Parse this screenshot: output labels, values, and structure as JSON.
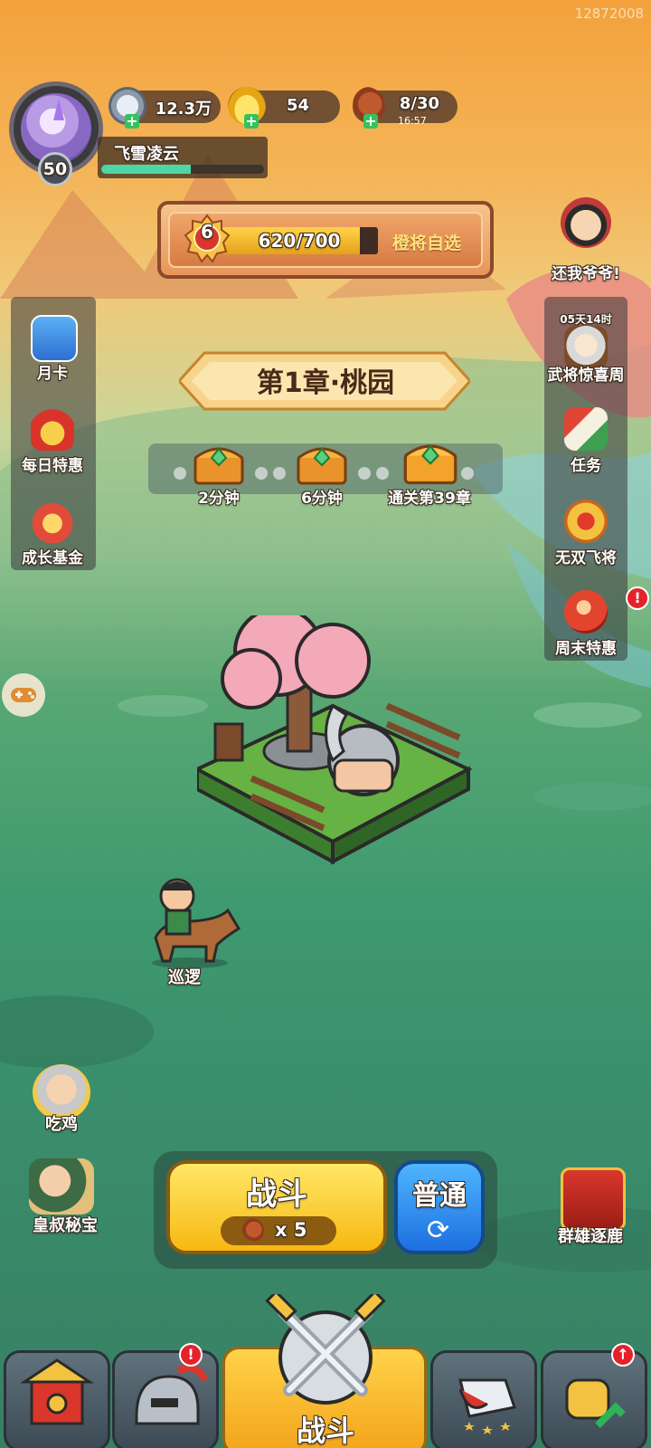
{
  "user_id": "12872008",
  "player": {
    "name": "飞雪凌云",
    "level": "50",
    "xp_fraction": 0.55
  },
  "resources": {
    "silver": {
      "value": "12.3万",
      "icon": "silver-coin-icon"
    },
    "gold": {
      "value": "54",
      "icon": "gold-ingot-icon"
    },
    "stamina": {
      "value": "8/30",
      "timer": "16:57",
      "icon": "meat-drumstick-icon"
    }
  },
  "quest": {
    "rank": "6",
    "progress": "620/700",
    "progress_fraction": 0.886,
    "link": "橙将自选"
  },
  "left_menu": [
    {
      "label": "月卡",
      "icon": "monthly-card-icon"
    },
    {
      "label": "每日特惠",
      "icon": "daily-deal-bag-icon"
    },
    {
      "label": "成长基金",
      "icon": "growth-fund-icon"
    }
  ],
  "right_top": {
    "label": "还我爷爷!",
    "icon": "zhang-fei-head-icon"
  },
  "right_menu": [
    {
      "label": "武将惊喜周",
      "timer": "05天14时",
      "icon": "general-surprise-icon"
    },
    {
      "label": "任务",
      "icon": "task-scroll-icon"
    },
    {
      "label": "无双飞将",
      "icon": "peerless-general-icon"
    },
    {
      "label": "周末特惠",
      "icon": "weekend-deal-icon",
      "alert": "!"
    }
  ],
  "chapter": {
    "title": "第1章·桃园",
    "chests": [
      {
        "label": "2分钟"
      },
      {
        "label": "6分钟"
      },
      {
        "label": "通关第39章"
      }
    ]
  },
  "hero": {
    "label": "巡逻"
  },
  "left_bottom": [
    {
      "label": "吃鸡",
      "icon": "chicken-dinner-icon"
    },
    {
      "label": "皇叔秘宝",
      "icon": "uncle-treasure-icon"
    }
  ],
  "right_bottom": {
    "label": "群雄逐鹿",
    "icon": "warlords-banner-icon"
  },
  "battle": {
    "label": "战斗",
    "cost": "x 5",
    "mode": "普通"
  },
  "tabs": [
    {
      "name": "tab-city",
      "icon": "city-gate-icon"
    },
    {
      "name": "tab-equipment",
      "icon": "helmet-icon",
      "alert": "!"
    },
    {
      "name": "tab-battle",
      "label": "战斗",
      "icon": "crossed-swords-icon"
    },
    {
      "name": "tab-heroes",
      "icon": "heroes-icon"
    },
    {
      "name": "tab-upgrade",
      "icon": "fist-upgrade-icon",
      "alert": "↑"
    }
  ],
  "colors": {
    "sky_top": "#f3a23c",
    "grass": "#3f9a6f",
    "battle_yellow": "#ffd24a",
    "mode_blue": "#1d6fe0",
    "alert_red": "#e5222b"
  }
}
